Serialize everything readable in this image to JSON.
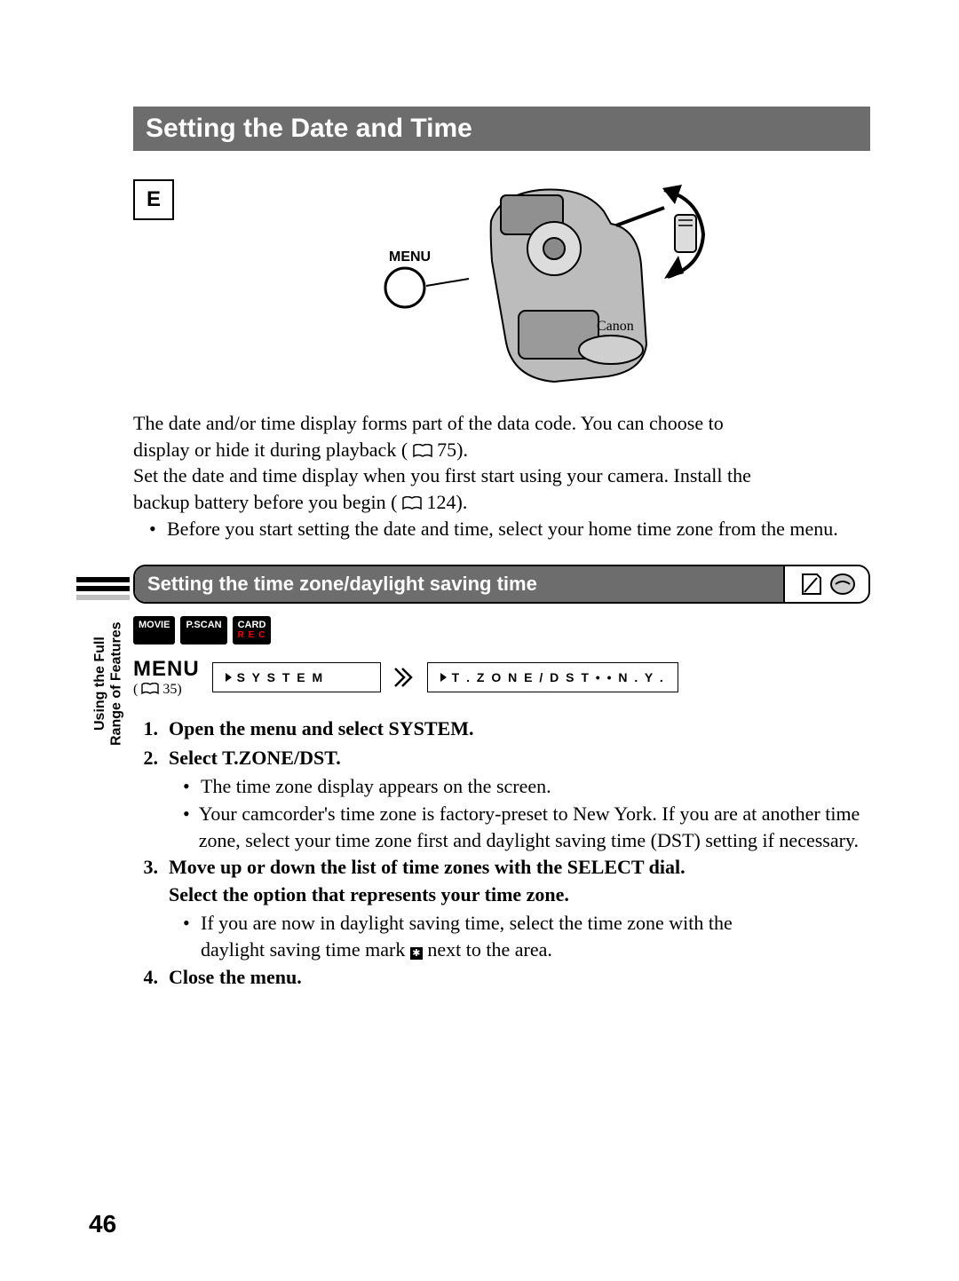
{
  "title": "Setting the Date and Time",
  "e_badge": "E",
  "illustration_label": "MENU",
  "intro": {
    "l1a": "The date and/or time display forms part of the data code. You can choose to",
    "l1b": "display or hide it during playback (",
    "ref1": "75).",
    "l2a": "Set the date and time display when you first start using your camera. Install the",
    "l2b": "backup battery before you begin (",
    "ref2": "124).",
    "bullet": "Before you start setting the date and time, select your home time zone from the menu."
  },
  "section_title": "Setting the time zone/daylight saving time",
  "modes": {
    "movie": "MOVIE",
    "pscan": "P.SCAN",
    "card": "CARD",
    "card_sub": "R E C"
  },
  "menu": {
    "label": "MENU",
    "ref": "35)",
    "box1": "S Y S T E M",
    "box2": "T . Z O N E / D S T • • N . Y ."
  },
  "steps": {
    "s1": {
      "n": "1.",
      "h": "Open the menu and select SYSTEM."
    },
    "s2": {
      "n": "2.",
      "h": "Select T.ZONE/DST.",
      "b1": "The time zone display appears on the screen.",
      "b2": "Your camcorder's time zone is factory-preset to New York. If you are at another time zone, select your time zone first and daylight saving time (DST) setting if necessary."
    },
    "s3": {
      "n": "3.",
      "h1": "Move up or down the list of time zones with the SELECT dial.",
      "h2": "Select the option that represents your time zone.",
      "b1a": "If you are now in daylight saving time, select the time zone with the",
      "b1b": "daylight saving time mark ",
      "b1c": " next to the area."
    },
    "s4": {
      "n": "4.",
      "h": "Close the menu."
    }
  },
  "side": {
    "l1": "Using the Full",
    "l2": "Range of Features"
  },
  "page_number": "46",
  "dst_mark_glyph": "✱"
}
